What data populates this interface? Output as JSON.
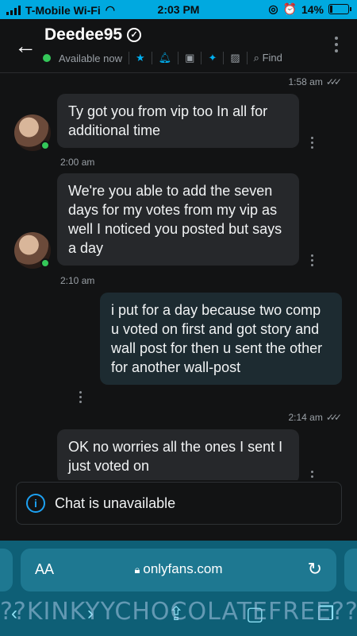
{
  "status_bar": {
    "carrier": "T-Mobile Wi-Fi",
    "time": "2:03 PM",
    "battery": "14%",
    "battery_level": 0.14
  },
  "header": {
    "username": "Deedee95",
    "status": "Available now",
    "find_label": "Find"
  },
  "messages": [
    {
      "type": "incoming",
      "text": "Ty got you from vip too In all for additional time",
      "time": "2:00 am"
    },
    {
      "type": "incoming",
      "text": "We're you able to add the seven days for my votes from my vip as well I noticed you posted but says a day",
      "time": "2:10 am"
    },
    {
      "type": "outgoing",
      "text": "i put for a day because two comp u voted on first and got story and wall post for then u sent the other for another wall-post",
      "time": "2:14 am"
    },
    {
      "type": "incoming",
      "text": "OK no worries all the ones I sent I just voted on",
      "time": ""
    }
  ],
  "top_timestamp": "1:58 am",
  "notice": {
    "text": "Chat is unavailable"
  },
  "browser": {
    "aa_label": "AA",
    "url": "onlyfans.com"
  },
  "watermark": "??KINKYYCHOCOLATEFREE??",
  "colors": {
    "accent": "#00aff0",
    "online": "#34c759",
    "status_bar": "#00a9e0",
    "browser_chrome": "#0e5f76"
  }
}
